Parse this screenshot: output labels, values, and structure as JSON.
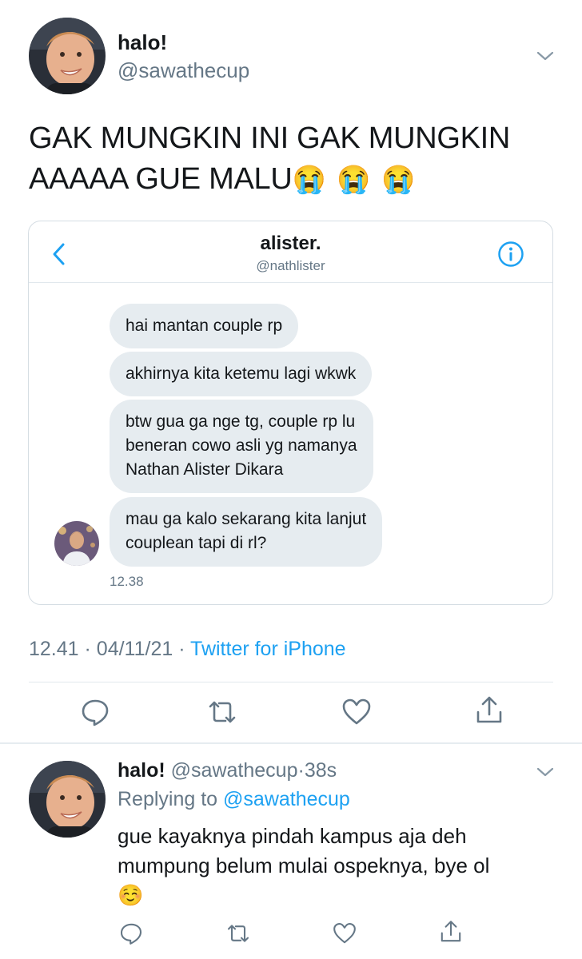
{
  "main_tweet": {
    "display_name": "halo!",
    "handle": "@sawathecup",
    "text_line1": "GAK MUNGKIN INI GAK MUNGKIN",
    "text_line2": "AAAAA GUE MALU",
    "emojis": "😭 😭 😭",
    "time": "12.41",
    "separator": "·",
    "date": "04/11/21",
    "source": "Twitter for iPhone"
  },
  "dm_screenshot": {
    "contact_name": "alister.",
    "contact_handle": "@nathlister",
    "messages": [
      "hai mantan couple rp",
      "akhirnya kita ketemu lagi wkwk",
      "btw gua ga nge tg, couple rp lu beneran cowo asli yg namanya Nathan Alister Dikara",
      "mau ga kalo sekarang kita lanjut couplean tapi di rl?"
    ],
    "message_lines": [
      [
        "hai mantan couple rp"
      ],
      [
        "akhirnya kita ketemu lagi wkwk"
      ],
      [
        "btw gua ga nge tg, couple rp lu",
        "beneran cowo asli yg namanya",
        "Nathan Alister Dikara"
      ],
      [
        "mau ga kalo sekarang kita lanjut",
        "couplean tapi di rl?"
      ]
    ],
    "timestamp": "12.38"
  },
  "reply": {
    "display_name": "halo!",
    "handle": "@sawathecup",
    "age": "38s",
    "replying_label": "Replying to",
    "replying_to": "@sawathecup",
    "text_line1": "gue kayaknya pindah kampus aja deh",
    "text_line2": "mumpung belum mulai ospeknya, bye ol",
    "emoji": "☺️"
  },
  "icons": [
    "chevron-down-icon",
    "back-arrow-icon",
    "info-icon",
    "reply-icon",
    "retweet-icon",
    "like-icon",
    "share-icon"
  ],
  "colors": {
    "accent": "#1da1f2",
    "secondary_text": "#657786",
    "bubble": "#e6ecf0",
    "border": "#e1e8ed"
  }
}
